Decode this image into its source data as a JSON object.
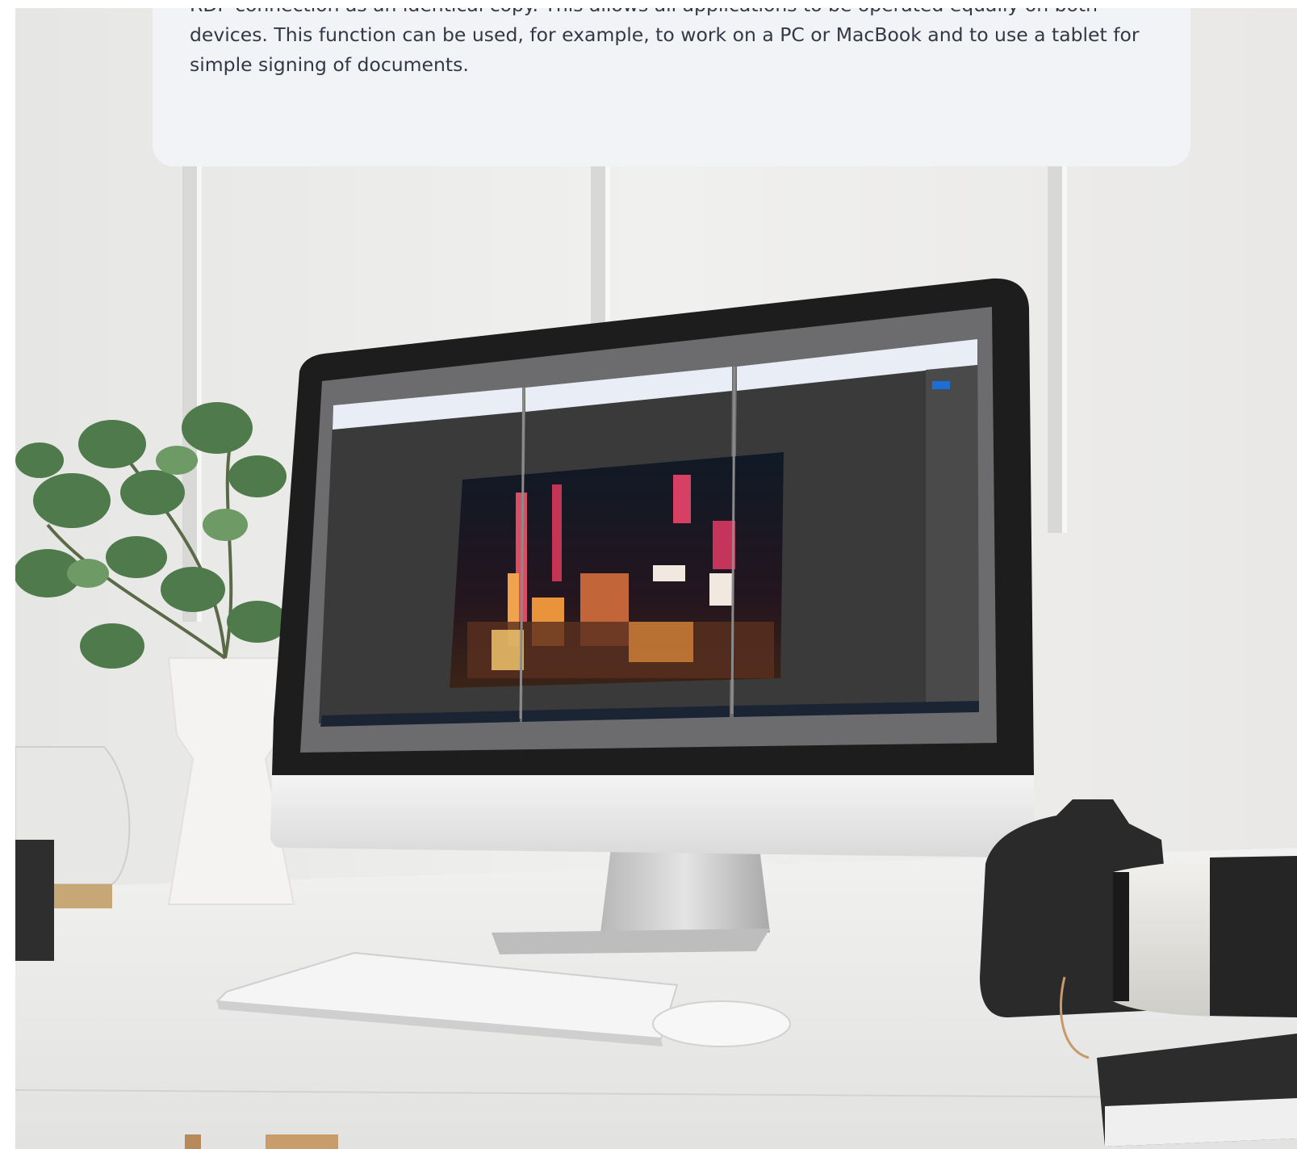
{
  "info_card": {
    "text": "RDP connection as an identical copy. This allows all applications to be operated equally on both devices. This function can be used, for example, to work on a PC or MacBook and to use a tablet for simple signing of documents."
  },
  "colors": {
    "card_background": "#f2f3f6",
    "card_text": "#333845",
    "wall": "#ecebe9",
    "desk": "#e8e8e7",
    "screen_canvas": "#3a3a3a",
    "browser_bar": "#e9eef6"
  }
}
